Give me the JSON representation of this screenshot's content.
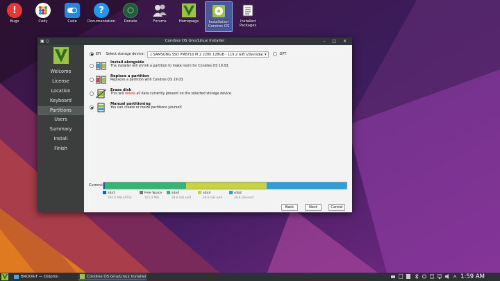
{
  "desktop": {
    "icons": [
      {
        "label": "Bugs",
        "icon": "bug-report-icon",
        "color": "#e53935"
      },
      {
        "label": "Cedy",
        "icon": "cedy-app-icon",
        "color": "#ffffff"
      },
      {
        "label": "Code",
        "icon": "code-toggle-icon",
        "color": "#2196f3"
      },
      {
        "label": "Documentation",
        "icon": "help-icon",
        "color": "#2196f3"
      },
      {
        "label": "Donate",
        "icon": "donate-icon",
        "color": "#2e7d32"
      },
      {
        "label": "Forums",
        "icon": "forums-users-icon",
        "color": "#bdbdbd"
      },
      {
        "label": "Homepage",
        "icon": "homepage-logo-icon",
        "color": "#9bc53d"
      },
      {
        "label": "Installation Condres OS",
        "icon": "installer-icon",
        "color": "#9bc53d"
      },
      {
        "label": "Installed Packages",
        "icon": "packages-list-icon",
        "color": "#ffffff"
      }
    ]
  },
  "window": {
    "title": "Condres OS Gnu/Linux Installer",
    "controls": "– □ ✕"
  },
  "sidebar": {
    "items": [
      {
        "label": "Welcome",
        "active": false
      },
      {
        "label": "License",
        "active": false
      },
      {
        "label": "Location",
        "active": false
      },
      {
        "label": "Keyboard",
        "active": false
      },
      {
        "label": "Partitions",
        "active": true
      },
      {
        "label": "Users",
        "active": false
      },
      {
        "label": "Summary",
        "active": false
      },
      {
        "label": "Install",
        "active": false
      },
      {
        "label": "Finish",
        "active": false
      }
    ]
  },
  "partition": {
    "efi_label": "EFI",
    "storage_label": "Select storage device:",
    "device_value": "SAMSUNG SSD PM871b M.2 2280 128GB - 119.2 GiB (/dev/sda)",
    "gpt_label": "GPT",
    "options": [
      {
        "title": "Install alongside",
        "desc": "The installer will shrink a partition to make room for Condres OS 19.03."
      },
      {
        "title": "Replace a partition",
        "desc": "Replaces a partition with Condres OS 19.03."
      },
      {
        "title": "Erase disk",
        "desc_before": "This will ",
        "desc_danger": "delete",
        "desc_after": " all data currently present on the selected storage device."
      },
      {
        "title": "Manual partitioning",
        "desc": "You can create or resize partitions yourself."
      }
    ],
    "selected_option": 3,
    "current_label": "Current:",
    "segments": [
      {
        "name": "sda1",
        "size": "500.0 MiB",
        "fs": "FAT32",
        "color": "#1f5fa8",
        "fraction": 0.005
      },
      {
        "name": "Free Space",
        "size": "103.0 MiB",
        "fs": "",
        "color": "#777777",
        "fraction": 0.002
      },
      {
        "name": "sda4",
        "size": "39.6 GiB",
        "fs": "ext4",
        "color": "#2eb872",
        "fraction": 0.332
      },
      {
        "name": "sda3",
        "size": "39.6 GiB",
        "fs": "ext4",
        "color": "#c7d636",
        "fraction": 0.332
      },
      {
        "name": "sda2",
        "size": "39.6 GiB",
        "fs": "ext4",
        "color": "#2a9fe0",
        "fraction": 0.329
      }
    ],
    "buttons": {
      "back": "Back",
      "next": "Next",
      "cancel": "Cancel"
    }
  },
  "taskbar": {
    "tasks": [
      {
        "label": "BROOK-T — Dolphin",
        "active": false
      },
      {
        "label": "Condres OS Gnu/Linux Installer",
        "active": true
      }
    ],
    "clock": "1:59 AM"
  }
}
